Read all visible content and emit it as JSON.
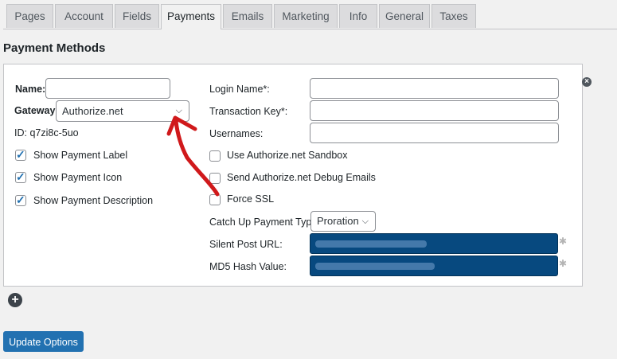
{
  "tabs": [
    "Pages",
    "Account",
    "Fields",
    "Payments",
    "Emails",
    "Marketing",
    "Info",
    "General",
    "Taxes"
  ],
  "active_tab": "Payments",
  "section_title": "Payment Methods",
  "method": {
    "name_label": "Name:",
    "name_value": "",
    "gateway_label": "Gateway:",
    "gateway_value": "Authorize.net",
    "id_text": "ID: q7zi8c-5uo",
    "show_label": {
      "label": "Show Payment Label",
      "checked": true
    },
    "show_icon": {
      "label": "Show Payment Icon",
      "checked": true
    },
    "show_description": {
      "label": "Show Payment Description",
      "checked": true
    }
  },
  "gateway_settings": {
    "login_name_label": "Login Name*:",
    "transaction_key_label": "Transaction Key*:",
    "usernames_label": "Usernames:",
    "sandbox": {
      "label": "Use Authorize.net Sandbox",
      "checked": false
    },
    "debug_emails": {
      "label": "Send Authorize.net Debug Emails",
      "checked": false
    },
    "force_ssl": {
      "label": "Force SSL",
      "checked": false
    },
    "catch_up_label": "Catch Up Payment Type",
    "catch_up_value": "Proration",
    "silent_post_label": "Silent Post URL:",
    "md5_label": "MD5 Hash Value:"
  },
  "icons": {
    "remove": "close-circle-icon",
    "add": "plus-circle-icon",
    "copy": "puzzle-icon",
    "dropdown": "chevron-down-icon"
  },
  "colors": {
    "primary": "#2271b1",
    "masked_field": "#07497f",
    "annotation_arrow": "#d0191b"
  },
  "update_button": "Update Options"
}
